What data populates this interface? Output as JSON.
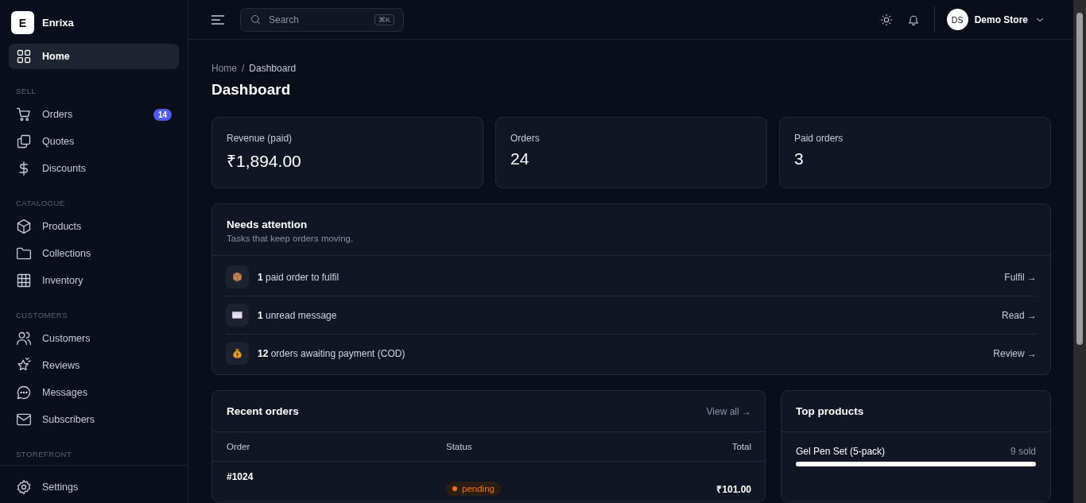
{
  "brand": {
    "initial": "E",
    "name": "Enrixa"
  },
  "sidebar": {
    "home": {
      "label": "Home",
      "kind": "grid",
      "selected": true
    },
    "sections": [
      {
        "title": "SELL",
        "items": [
          {
            "label": "Orders",
            "kind": "cart",
            "badge": "14",
            "selected": false
          },
          {
            "label": "Quotes",
            "kind": "copy",
            "selected": false
          },
          {
            "label": "Discounts",
            "kind": "dollar",
            "selected": false
          }
        ]
      },
      {
        "title": "CATALOGUE",
        "items": [
          {
            "label": "Products",
            "kind": "cube",
            "selected": false
          },
          {
            "label": "Collections",
            "kind": "folder",
            "selected": false
          },
          {
            "label": "Inventory",
            "kind": "table",
            "selected": false
          }
        ]
      },
      {
        "title": "CUSTOMERS",
        "items": [
          {
            "label": "Customers",
            "kind": "users",
            "selected": false
          },
          {
            "label": "Reviews",
            "kind": "star",
            "selected": false
          },
          {
            "label": "Messages",
            "kind": "chat",
            "selected": false
          },
          {
            "label": "Subscribers",
            "kind": "mail",
            "selected": false
          }
        ]
      },
      {
        "title": "STOREFRONT"
      }
    ],
    "footer": {
      "label": "Settings",
      "kind": "gear",
      "selected": false
    }
  },
  "topbar": {
    "search": {
      "placeholder": "Search",
      "shortcut": "⌘K"
    },
    "user": {
      "initials": "DS",
      "name": "Demo Store"
    }
  },
  "breadcrumb": {
    "items": [
      "Home",
      "Dashboard"
    ],
    "separator": "/"
  },
  "page_title": "Dashboard",
  "stats": [
    {
      "label": "Revenue (paid)",
      "value": "₹1,894.00"
    },
    {
      "label": "Orders",
      "value": "24"
    },
    {
      "label": "Paid orders",
      "value": "3"
    }
  ],
  "attention": {
    "title": "Needs attention",
    "subtitle": "Tasks that keep orders moving.",
    "tasks": [
      {
        "kind": "package",
        "count": "1",
        "text": "paid order to fulfil",
        "action": "Fulfil →"
      },
      {
        "kind": "envelope",
        "count": "1",
        "text": "unread message",
        "action": "Read →"
      },
      {
        "kind": "moneybag",
        "count": "12",
        "text": "orders awaiting payment (COD)",
        "action": "Review →"
      }
    ]
  },
  "recent_orders": {
    "title": "Recent orders",
    "link": "View all →",
    "columns": [
      "Order",
      "Status",
      "Total"
    ],
    "rows": [
      {
        "order": "#1024",
        "status": {
          "label": "pending",
          "color": "#f97316"
        },
        "total": "₹101.00"
      }
    ]
  },
  "top_products": {
    "title": "Top products",
    "items": [
      {
        "name": "Gel Pen Set (5-pack)",
        "sold": "9 sold",
        "level": 1.0
      }
    ]
  }
}
